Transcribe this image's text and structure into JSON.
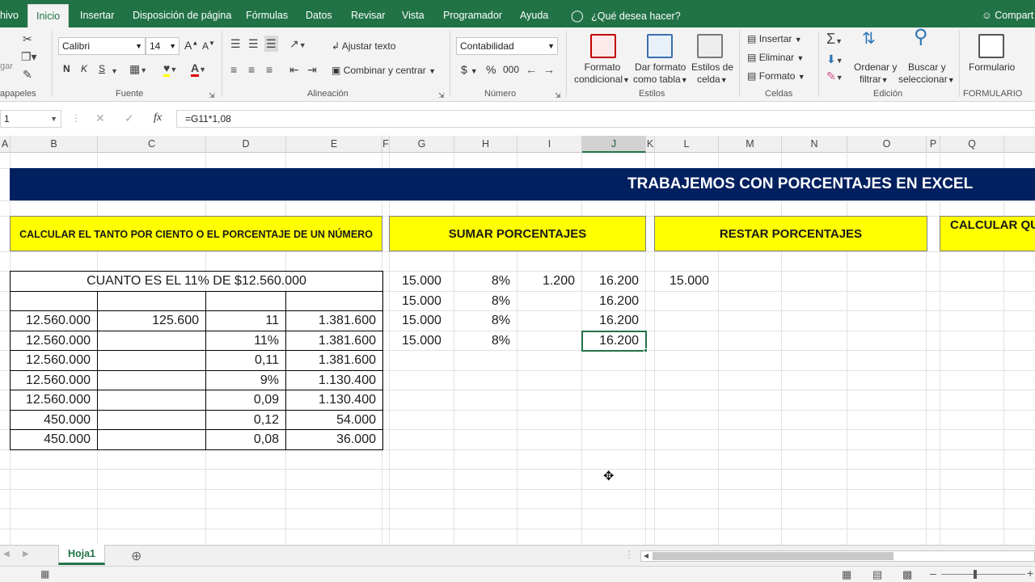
{
  "ribbon_tabs": [
    "hivo",
    "Inicio",
    "Insertar",
    "Disposición de página",
    "Fórmulas",
    "Datos",
    "Revisar",
    "Vista",
    "Programador",
    "Ayuda",
    "¿Qué desea hacer?",
    "Compart"
  ],
  "clipboard": {
    "label": "apapeles",
    "paste_hint": "gar"
  },
  "font": {
    "name": "Calibri",
    "size": "14",
    "grow": "A",
    "shrink": "A",
    "bold": "N",
    "italic": "K",
    "underline": "S",
    "label": "Fuente"
  },
  "alignment": {
    "wrap_text": "Ajustar texto",
    "merge_center": "Combinar y centrar",
    "label": "Alineación"
  },
  "number": {
    "format": "Contabilidad",
    "currency": "$",
    "percent": "%",
    "thousands": "000",
    "label": "Número"
  },
  "styles": {
    "conditional": [
      "Formato",
      "condicional"
    ],
    "as_table": [
      "Dar formato",
      "como tabla"
    ],
    "cell_styles": [
      "Estilos de",
      "celda"
    ],
    "label": "Estilos"
  },
  "cells": {
    "insert": "Insertar",
    "delete": "Eliminar",
    "format": "Formato",
    "label": "Celdas"
  },
  "editing": {
    "sort": [
      "Ordenar y",
      "filtrar"
    ],
    "find": [
      "Buscar y",
      "seleccionar"
    ],
    "label": "Edición"
  },
  "form": {
    "button": "Formulario",
    "label": "FORMULARIO"
  },
  "formula_bar": {
    "name_box": "1",
    "formula": "=G11*1,08",
    "fx": "fx"
  },
  "columns": [
    "A",
    "B",
    "C",
    "D",
    "E",
    "F",
    "G",
    "H",
    "I",
    "J",
    "K",
    "L",
    "M",
    "N",
    "O",
    "P",
    "Q"
  ],
  "selected_column": "J",
  "banner": "TRABAJEMOS CON PORCENTAJES EN EXCEL",
  "sections": {
    "calc_percent": "CALCULAR EL TANTO POR CIENTO O EL PORCENTAJE  DE UN NÚMERO",
    "add_percent": "SUMAR PORCENTAJES",
    "subtract_percent": "RESTAR PORCENTAJES",
    "calc_which": "CALCULAR QU"
  },
  "table1": {
    "title": "CUANTO ES EL 11% DE $12.560.000",
    "rows": [
      [
        "",
        "",
        "",
        ""
      ],
      [
        "12.560.000",
        "125.600",
        "11",
        "1.381.600"
      ],
      [
        "12.560.000",
        "",
        "11%",
        "1.381.600"
      ],
      [
        "12.560.000",
        "",
        "0,11",
        "1.381.600"
      ],
      [
        "12.560.000",
        "",
        "9%",
        "1.130.400"
      ],
      [
        "12.560.000",
        "",
        "0,09",
        "1.130.400"
      ],
      [
        "450.000",
        "",
        "0,12",
        "54.000"
      ],
      [
        "450.000",
        "",
        "0,08",
        "36.000"
      ]
    ]
  },
  "table2": {
    "rows": [
      [
        "15.000",
        "8%",
        "1.200",
        "16.200"
      ],
      [
        "15.000",
        "8%",
        "",
        "16.200"
      ],
      [
        "15.000",
        "8%",
        "",
        "16.200"
      ],
      [
        "15.000",
        "8%",
        "",
        "16.200"
      ]
    ]
  },
  "table3": {
    "l_value": "15.000"
  },
  "sheet_tab": "Hoja1",
  "colors": {
    "excel_green": "#217346",
    "banner_blue": "#002060",
    "highlight_yellow": "#ffff00"
  }
}
